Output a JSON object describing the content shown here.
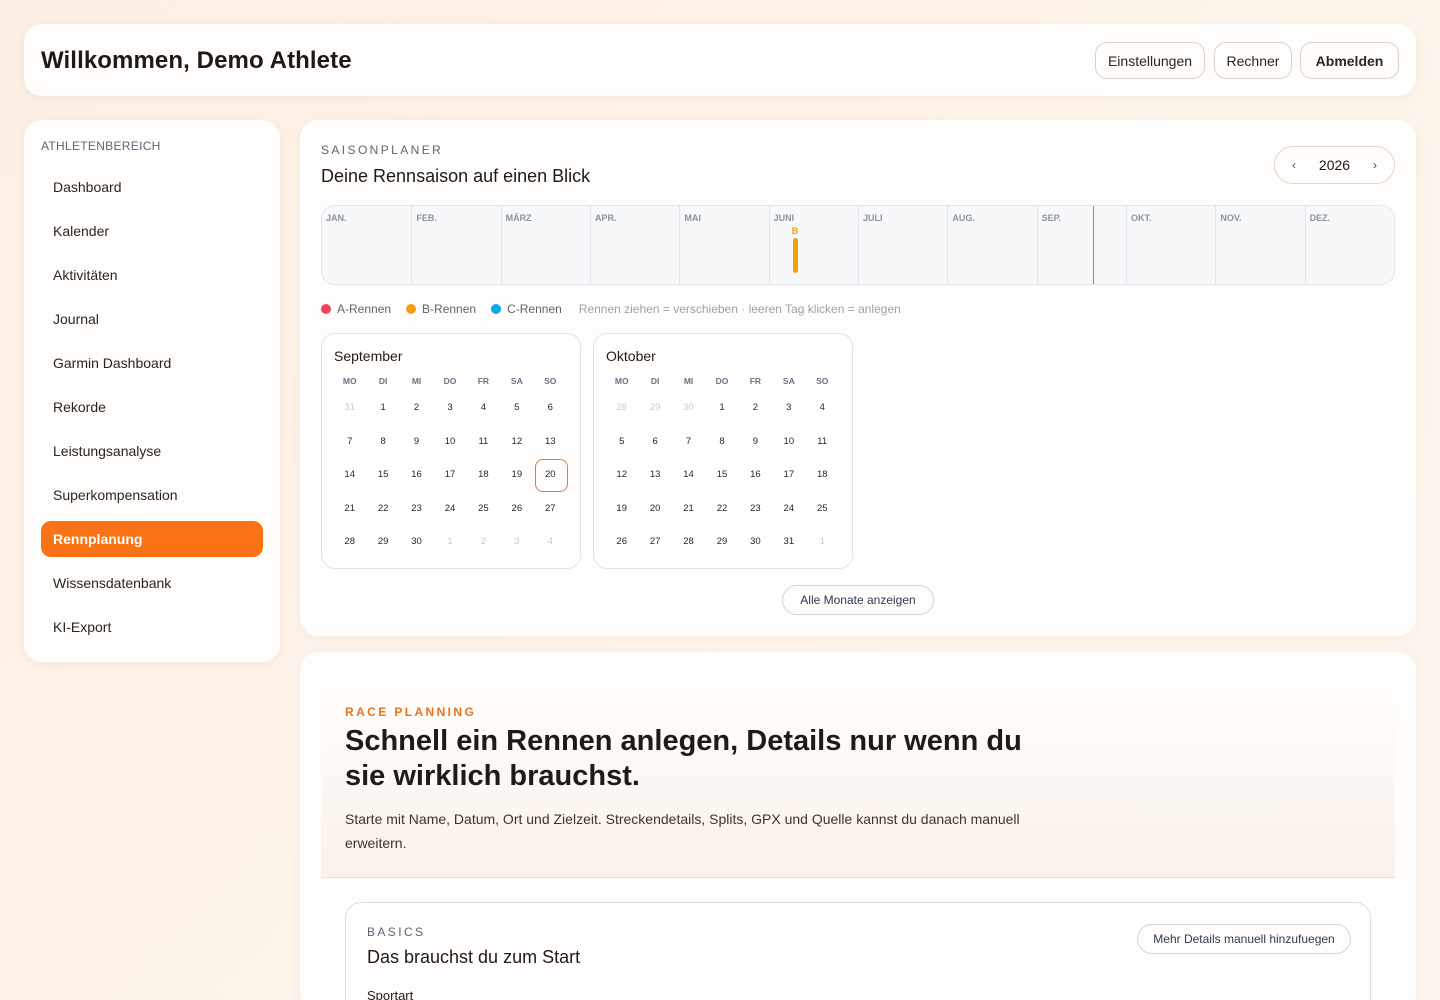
{
  "header": {
    "title": "Willkommen, Demo Athlete",
    "buttons": [
      "Einstellungen",
      "Rechner",
      "Abmelden"
    ]
  },
  "sidebar": {
    "section": "ATHLETENBEREICH",
    "items": [
      {
        "label": "Dashboard",
        "active": false
      },
      {
        "label": "Kalender",
        "active": false
      },
      {
        "label": "Aktivitäten",
        "active": false
      },
      {
        "label": "Journal",
        "active": false
      },
      {
        "label": "Garmin Dashboard",
        "active": false
      },
      {
        "label": "Rekorde",
        "active": false
      },
      {
        "label": "Leistungsanalyse",
        "active": false
      },
      {
        "label": "Superkompensation",
        "active": false
      },
      {
        "label": "Rennplanung",
        "active": true
      },
      {
        "label": "Wissensdatenbank",
        "active": false
      },
      {
        "label": "KI-Export",
        "active": false
      }
    ]
  },
  "planner": {
    "eyebrow": "SAISONPLANER",
    "title": "Deine Rennsaison auf einen Blick",
    "year": "2026",
    "prev_icon": "‹",
    "next_icon": "›",
    "timeline_months": [
      "JAN.",
      "FEB.",
      "MÄRZ",
      "APR.",
      "MAI",
      "JUNI",
      "JULI",
      "AUG.",
      "SEP.",
      "OKT.",
      "NOV.",
      "DEZ."
    ],
    "timeline_race": {
      "label": "B",
      "month": "JUNI",
      "color": "#f59e0b"
    },
    "legend": [
      {
        "label": "A-Rennen",
        "color": "#f43f5e"
      },
      {
        "label": "B-Rennen",
        "color": "#f59e0b"
      },
      {
        "label": "C-Rennen",
        "color": "#0ea5e9"
      }
    ],
    "legend_hint": "Rennen ziehen = verschieben · leeren Tag klicken = anlegen",
    "weekdays": [
      "MO",
      "DI",
      "MI",
      "DO",
      "FR",
      "SA",
      "SO"
    ],
    "months": [
      {
        "name": "September",
        "weeks": [
          [
            "31",
            "1",
            "2",
            "3",
            "4",
            "5",
            "6"
          ],
          [
            "7",
            "8",
            "9",
            "10",
            "11",
            "12",
            "13"
          ],
          [
            "14",
            "15",
            "16",
            "17",
            "18",
            "19",
            "20"
          ],
          [
            "21",
            "22",
            "23",
            "24",
            "25",
            "26",
            "27"
          ],
          [
            "28",
            "29",
            "30",
            "1",
            "2",
            "3",
            "4"
          ]
        ],
        "other_leading": 1,
        "other_trailing": 4,
        "today": "20"
      },
      {
        "name": "Oktober",
        "weeks": [
          [
            "28",
            "29",
            "30",
            "1",
            "2",
            "3",
            "4"
          ],
          [
            "5",
            "6",
            "7",
            "8",
            "9",
            "10",
            "11"
          ],
          [
            "12",
            "13",
            "14",
            "15",
            "16",
            "17",
            "18"
          ],
          [
            "19",
            "20",
            "21",
            "22",
            "23",
            "24",
            "25"
          ],
          [
            "26",
            "27",
            "28",
            "29",
            "30",
            "31",
            "1"
          ]
        ],
        "other_leading": 3,
        "other_trailing": 1,
        "today": null
      }
    ],
    "show_all": "Alle Monate anzeigen"
  },
  "race": {
    "eyebrow": "RACE PLANNING",
    "title": "Schnell ein Rennen anlegen, Details nur wenn du sie wirklich brauchst.",
    "description": "Starte mit Name, Datum, Ort und Zielzeit. Streckendetails, Splits, GPX und Quelle kannst du danach manuell erweitern.",
    "basics": {
      "eyebrow": "BASICS",
      "title": "Das brauchst du zum Start",
      "button": "Mehr Details manuell hinzufuegen",
      "field_label": "Sportart"
    }
  },
  "colors": {
    "accent": "#f97316",
    "today_line": "#e8731f"
  }
}
